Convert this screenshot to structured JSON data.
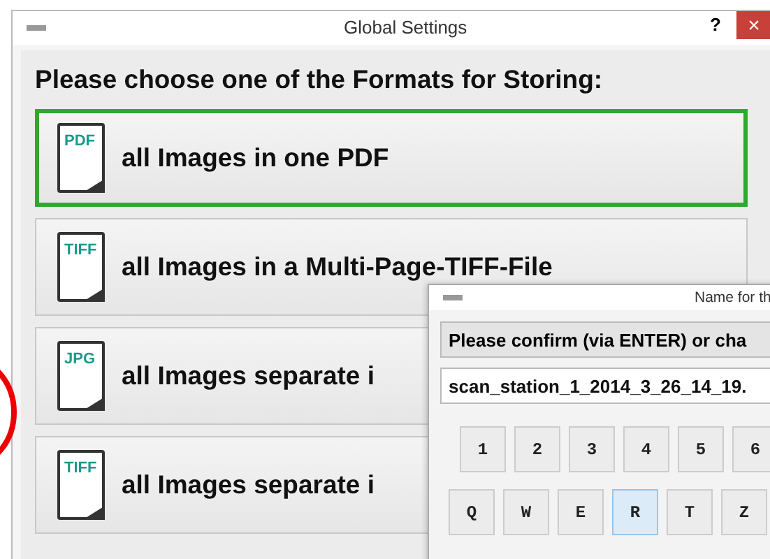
{
  "main_window": {
    "title": "Global Settings",
    "help": "?",
    "close": "×",
    "heading": "Please choose one of the Formats for Storing:",
    "options": [
      {
        "badge": "PDF",
        "label": "all Images in one PDF",
        "selected": true
      },
      {
        "badge": "TIFF",
        "label": "all Images in a Multi-Page-TIFF-File",
        "selected": false
      },
      {
        "badge": "JPG",
        "label": "all Images separate i",
        "selected": false
      },
      {
        "badge": "TIFF",
        "label": "all Images separate i",
        "selected": false
      }
    ]
  },
  "name_window": {
    "title": "Name for th",
    "prompt": "Please confirm (via ENTER) or cha",
    "value": "scan_station_1_2014_3_26_14_19.",
    "key_rows": [
      [
        {
          "label": "1",
          "selected": false
        },
        {
          "label": "2",
          "selected": false
        },
        {
          "label": "3",
          "selected": false
        },
        {
          "label": "4",
          "selected": false
        },
        {
          "label": "5",
          "selected": false
        },
        {
          "label": "6",
          "selected": false
        }
      ],
      [
        {
          "label": "Q",
          "selected": false
        },
        {
          "label": "W",
          "selected": false
        },
        {
          "label": "E",
          "selected": false
        },
        {
          "label": "R",
          "selected": true
        },
        {
          "label": "T",
          "selected": false
        },
        {
          "label": "Z",
          "selected": false
        }
      ]
    ]
  }
}
